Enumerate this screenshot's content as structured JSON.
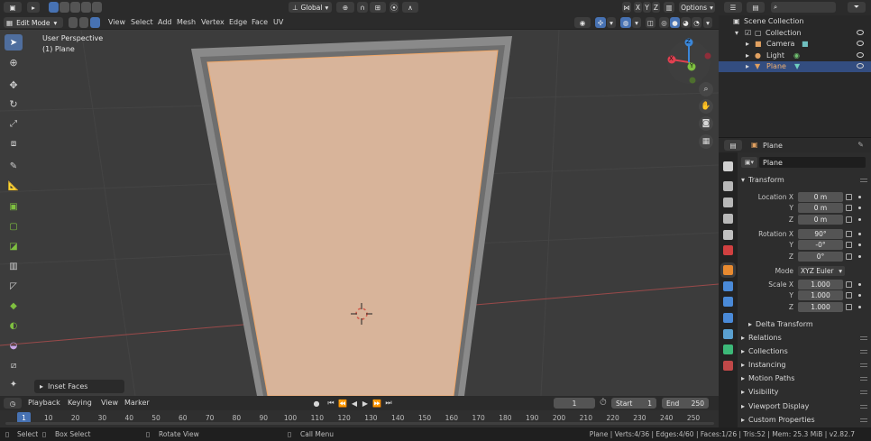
{
  "header": {
    "global": "Global",
    "axes": [
      "X",
      "Y",
      "Z"
    ],
    "options": "Options"
  },
  "viewport_header": {
    "mode": "Edit Mode",
    "menus": [
      "View",
      "Select",
      "Add",
      "Mesh",
      "Vertex",
      "Edge",
      "Face",
      "UV"
    ]
  },
  "viewport": {
    "perspective": "User Perspective",
    "object": "(1) Plane",
    "last_operator": "Inset Faces",
    "gizmo": {
      "x": "X",
      "y": "Y",
      "z": "Z"
    }
  },
  "outliner": {
    "rows": [
      {
        "label": "Scene Collection"
      },
      {
        "label": "Collection"
      },
      {
        "label": "Camera"
      },
      {
        "label": "Light"
      },
      {
        "label": "Plane"
      }
    ]
  },
  "properties": {
    "header_object": "Plane",
    "object_name": "Plane",
    "transform_title": "Transform",
    "location": {
      "label": "Location X",
      "x": "0 m",
      "y": "0 m",
      "z": "0 m"
    },
    "rotation": {
      "label": "Rotation X",
      "x": "90°",
      "y": "-0°",
      "z": "0°"
    },
    "mode": {
      "label": "Mode",
      "value": "XYZ Euler"
    },
    "scale": {
      "label": "Scale X",
      "x": "1.000",
      "y": "1.000",
      "z": "1.000"
    },
    "axis_y": "Y",
    "axis_z": "Z",
    "delta": "Delta Transform",
    "sections": [
      "Relations",
      "Collections",
      "Instancing",
      "Motion Paths",
      "Visibility",
      "Viewport Display",
      "Custom Properties"
    ]
  },
  "timeline": {
    "menus": [
      "Playback",
      "Keying",
      "View",
      "Marker"
    ],
    "current_frame": "1",
    "start_label": "Start",
    "start": "1",
    "end_label": "End",
    "end": "250",
    "ticks": [
      "1",
      "10",
      "20",
      "30",
      "40",
      "50",
      "60",
      "70",
      "80",
      "90",
      "100",
      "110",
      "120",
      "130",
      "140",
      "150",
      "160",
      "170",
      "180",
      "190",
      "200",
      "210",
      "220",
      "230",
      "240",
      "250"
    ]
  },
  "status": {
    "select": "Select",
    "box_select": "Box Select",
    "rotate_view": "Rotate View",
    "call_menu": "Call Menu",
    "stats": "Plane | Verts:4/36 | Edges:4/60 | Faces:1/26 | Tris:52 | Mem: 25.3 MiB | v2.82.7"
  },
  "colors": {
    "face_selected": "#d8b49a",
    "accent_blue": "#4772b3",
    "x_axis": "#e04050",
    "y_axis": "#7fc040",
    "z_axis": "#3a86d8"
  }
}
